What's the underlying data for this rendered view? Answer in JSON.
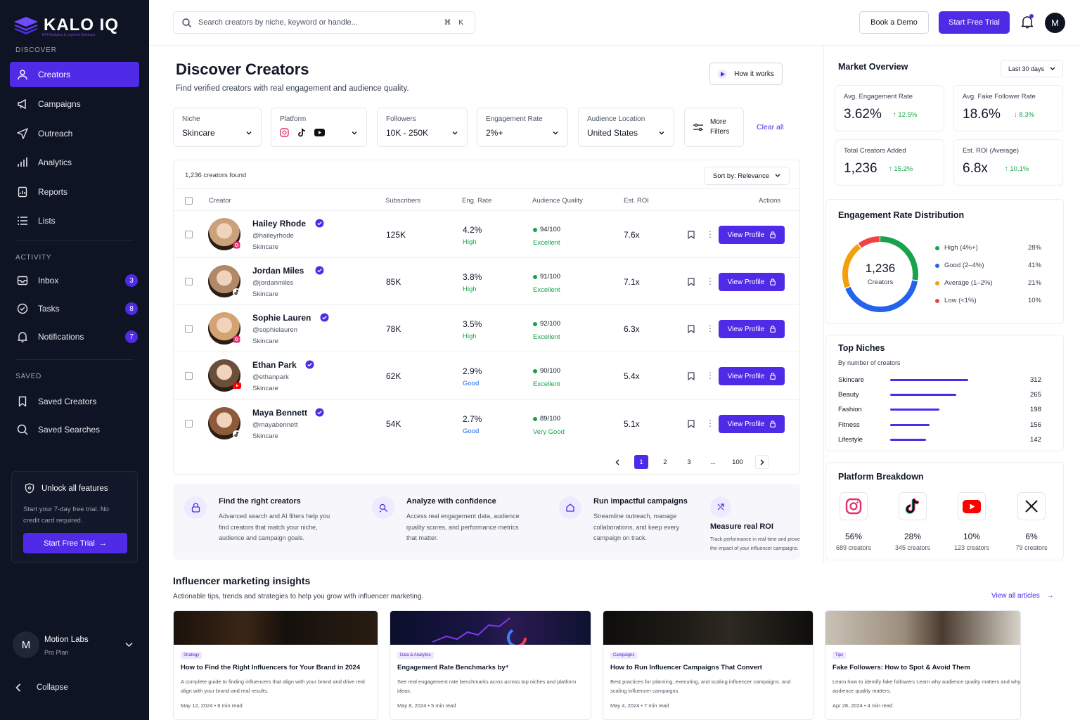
{
  "brand": {
    "name": "KALO IQ",
    "tagline": "KPI Analytics & Layered Outreach"
  },
  "sidebar": {
    "discover_label": "DISCOVER",
    "discover": [
      {
        "label": "Creators"
      },
      {
        "label": "Campaigns"
      },
      {
        "label": "Outreach"
      },
      {
        "label": "Analytics"
      },
      {
        "label": "Reports"
      },
      {
        "label": "Lists"
      }
    ],
    "activity_label": "ACTIVITY",
    "activity": [
      {
        "label": "Inbox",
        "badge": "3"
      },
      {
        "label": "Tasks",
        "badge": "8"
      },
      {
        "label": "Notifications",
        "badge": "7"
      }
    ],
    "saved_label": "SAVED",
    "saved": [
      {
        "label": "Saved Creators"
      },
      {
        "label": "Saved Searches"
      }
    ],
    "unlock": {
      "title": "Unlock all features",
      "text_line1": "Start your 7-day free trial. No",
      "text_line2": "credit card required.",
      "button": "Start Free Trial"
    },
    "user": {
      "initial": "M",
      "name": "Motion Labs",
      "plan": "Pro Plan"
    },
    "collapse": "Collapse"
  },
  "topbar": {
    "search_placeholder": "Search creators by niche, keyword or handle...",
    "shortcut": "⌘ K",
    "book_demo": "Book a Demo",
    "start_trial": "Start Free Trial",
    "avatar_initial": "M"
  },
  "header": {
    "title": "Discover Creators",
    "subtitle": "Find verified creators with real engagement and audience quality.",
    "how_it_works": "How it works"
  },
  "filters": {
    "niche": {
      "label": "Niche",
      "value": "Skincare"
    },
    "platform": {
      "label": "Platform"
    },
    "followers": {
      "label": "Followers",
      "value": "10K - 250K"
    },
    "engagement": {
      "label": "Engagement Rate",
      "value": "2%+"
    },
    "location": {
      "label": "Audience Location",
      "value": "United States"
    },
    "more_line1": "More",
    "more_line2": "Filters",
    "clear": "Clear all"
  },
  "results": {
    "count": "1,236 creators found",
    "sort": "Sort by: Relevance"
  },
  "table": {
    "headers": {
      "creator": "Creator",
      "subscribers": "Subscribers",
      "eng_rate": "Eng. Rate",
      "audience": "Audience Quality",
      "roi": "Est. ROI",
      "actions": "Actions"
    },
    "view_label": "View Profile",
    "rows": [
      {
        "name": "Hailey Rhode",
        "handle": "@haileyrhode",
        "niche": "Skincare",
        "subs": "125K",
        "eng": "4.2%",
        "eng_tier": "High",
        "aq": "94/100",
        "aq_label": "Excellent",
        "roi": "7.6x",
        "platform": "instagram"
      },
      {
        "name": "Jordan Miles",
        "handle": "@jordanmiles",
        "niche": "Skincare",
        "subs": "85K",
        "eng": "3.8%",
        "eng_tier": "High",
        "aq": "91/100",
        "aq_label": "Excellent",
        "roi": "7.1x",
        "platform": "tiktok"
      },
      {
        "name": "Sophie Lauren",
        "handle": "@sophielauren",
        "niche": "Skincare",
        "subs": "78K",
        "eng": "3.5%",
        "eng_tier": "High",
        "aq": "92/100",
        "aq_label": "Excellent",
        "roi": "6.3x",
        "platform": "instagram"
      },
      {
        "name": "Ethan Park",
        "handle": "@ethanpark",
        "niche": "Skincare",
        "subs": "62K",
        "eng": "2.9%",
        "eng_tier": "Good",
        "aq": "90/100",
        "aq_label": "Excellent",
        "roi": "5.4x",
        "platform": "youtube"
      },
      {
        "name": "Maya Bennett",
        "handle": "@mayabennett",
        "niche": "Skincare",
        "subs": "54K",
        "eng": "2.7%",
        "eng_tier": "Good",
        "aq": "89/100",
        "aq_label": "Very Good",
        "roi": "5.1x",
        "platform": "tiktok"
      }
    ]
  },
  "pagination": {
    "pages": [
      "1",
      "2",
      "3",
      "...",
      "100"
    ],
    "current": "1"
  },
  "features": [
    {
      "title": "Find the right creators",
      "desc": [
        "Advanced search and AI filters help you",
        "find creators that match your niche,",
        "audience and campaign goals."
      ]
    },
    {
      "title": "Analyze with confidence",
      "desc": [
        "Access real engagement data, audience",
        "quality scores, and performance metrics",
        "that matter."
      ]
    },
    {
      "title": "Run impactful campaigns",
      "desc": [
        "Streamline outreach, manage",
        "collaborations, and keep every",
        "campaign on track."
      ]
    },
    {
      "title": "Measure real ROI",
      "desc": [
        "Track performance in real time and prove",
        "the impact of your influencer campaigns."
      ]
    }
  ],
  "market": {
    "title": "Market Overview",
    "range": "Last 30 days",
    "kpis": [
      {
        "label": "Avg. Engagement Rate",
        "value": "3.62%",
        "delta": "12.5%",
        "dir": "up"
      },
      {
        "label": "Avg. Fake Follower Rate",
        "value": "18.6%",
        "delta": "8.3%",
        "dir": "down"
      },
      {
        "label": "Total Creators Added",
        "value": "1,236",
        "delta": "15.2%",
        "dir": "up"
      },
      {
        "label": "Est. ROI (Average)",
        "value": "6.8x",
        "delta": "10.1%",
        "dir": "up"
      }
    ]
  },
  "distribution": {
    "title": "Engagement Rate Distribution",
    "center_value": "1,236",
    "center_label": "Creators",
    "segments": [
      {
        "label": "High (4%+)",
        "pct": "28%",
        "value": 28,
        "color": "#16a34a"
      },
      {
        "label": "Good (2–4%)",
        "pct": "41%",
        "value": 41,
        "color": "#2563eb"
      },
      {
        "label": "Average (1–2%)",
        "pct": "21%",
        "value": 21,
        "color": "#f59e0b"
      },
      {
        "label": "Low (<1%)",
        "pct": "10%",
        "value": 10,
        "color": "#ef4444"
      }
    ]
  },
  "niches": {
    "title": "Top Niches",
    "subtitle": "By number of creators",
    "max": 312,
    "items": [
      {
        "label": "Skincare",
        "value": 312
      },
      {
        "label": "Beauty",
        "value": 265
      },
      {
        "label": "Fashion",
        "value": 198
      },
      {
        "label": "Fitness",
        "value": 156
      },
      {
        "label": "Lifestyle",
        "value": 142
      }
    ]
  },
  "platforms": {
    "title": "Platform Breakdown",
    "items": [
      {
        "icon": "instagram-icon",
        "pct": "56%",
        "count": "689 creators"
      },
      {
        "icon": "tiktok-icon",
        "pct": "28%",
        "count": "345 creators"
      },
      {
        "icon": "youtube-icon",
        "pct": "10%",
        "count": "123 creators"
      },
      {
        "icon": "x-icon",
        "pct": "6%",
        "count": "79 creators"
      }
    ]
  },
  "insights": {
    "title": "Influencer marketing insights",
    "subtitle": "Actionable tips, trends and strategies to help you grow with influencer marketing.",
    "view_all": "View all articles",
    "articles": [
      {
        "tag": "Strategy",
        "title": "How to Find the Right Influencers   for Your Brand in 2024",
        "desc": "A complete guide to finding influencers    that align with your brand and drive real align with your brand and real results.",
        "meta": "May 12, 2024  •  6 min read"
      },
      {
        "tag": "Data & Analytics",
        "title": "Engagement Rate Benchmarks by⁴",
        "desc": "See real engagement rate benchmarks acros across top niches and platform ideas.",
        "meta": "May 8, 2024  •  5 min read"
      },
      {
        "tag": "Campaigns",
        "title": "How to Run Influencer Campaigns   That Convert",
        "desc": "Best practices for planning, executing,    and scaling influencer campaigns. and scaling influencer campaigns.",
        "meta": "May 4, 2024  •  7 min read"
      },
      {
        "tag": "Tips",
        "title": "Fake Followers: How to Spot   & Avoid Them",
        "desc": "Learn how to identify fake followers   Learn why audience quality matters and why audience quality matters.",
        "meta": "Apr 28, 2024  •  4 min read"
      }
    ]
  },
  "colors": {
    "accent": "#4f2be8",
    "sidebar_bg": "#0f1424",
    "positive": "#16a34a",
    "good_blue": "#2563eb"
  }
}
